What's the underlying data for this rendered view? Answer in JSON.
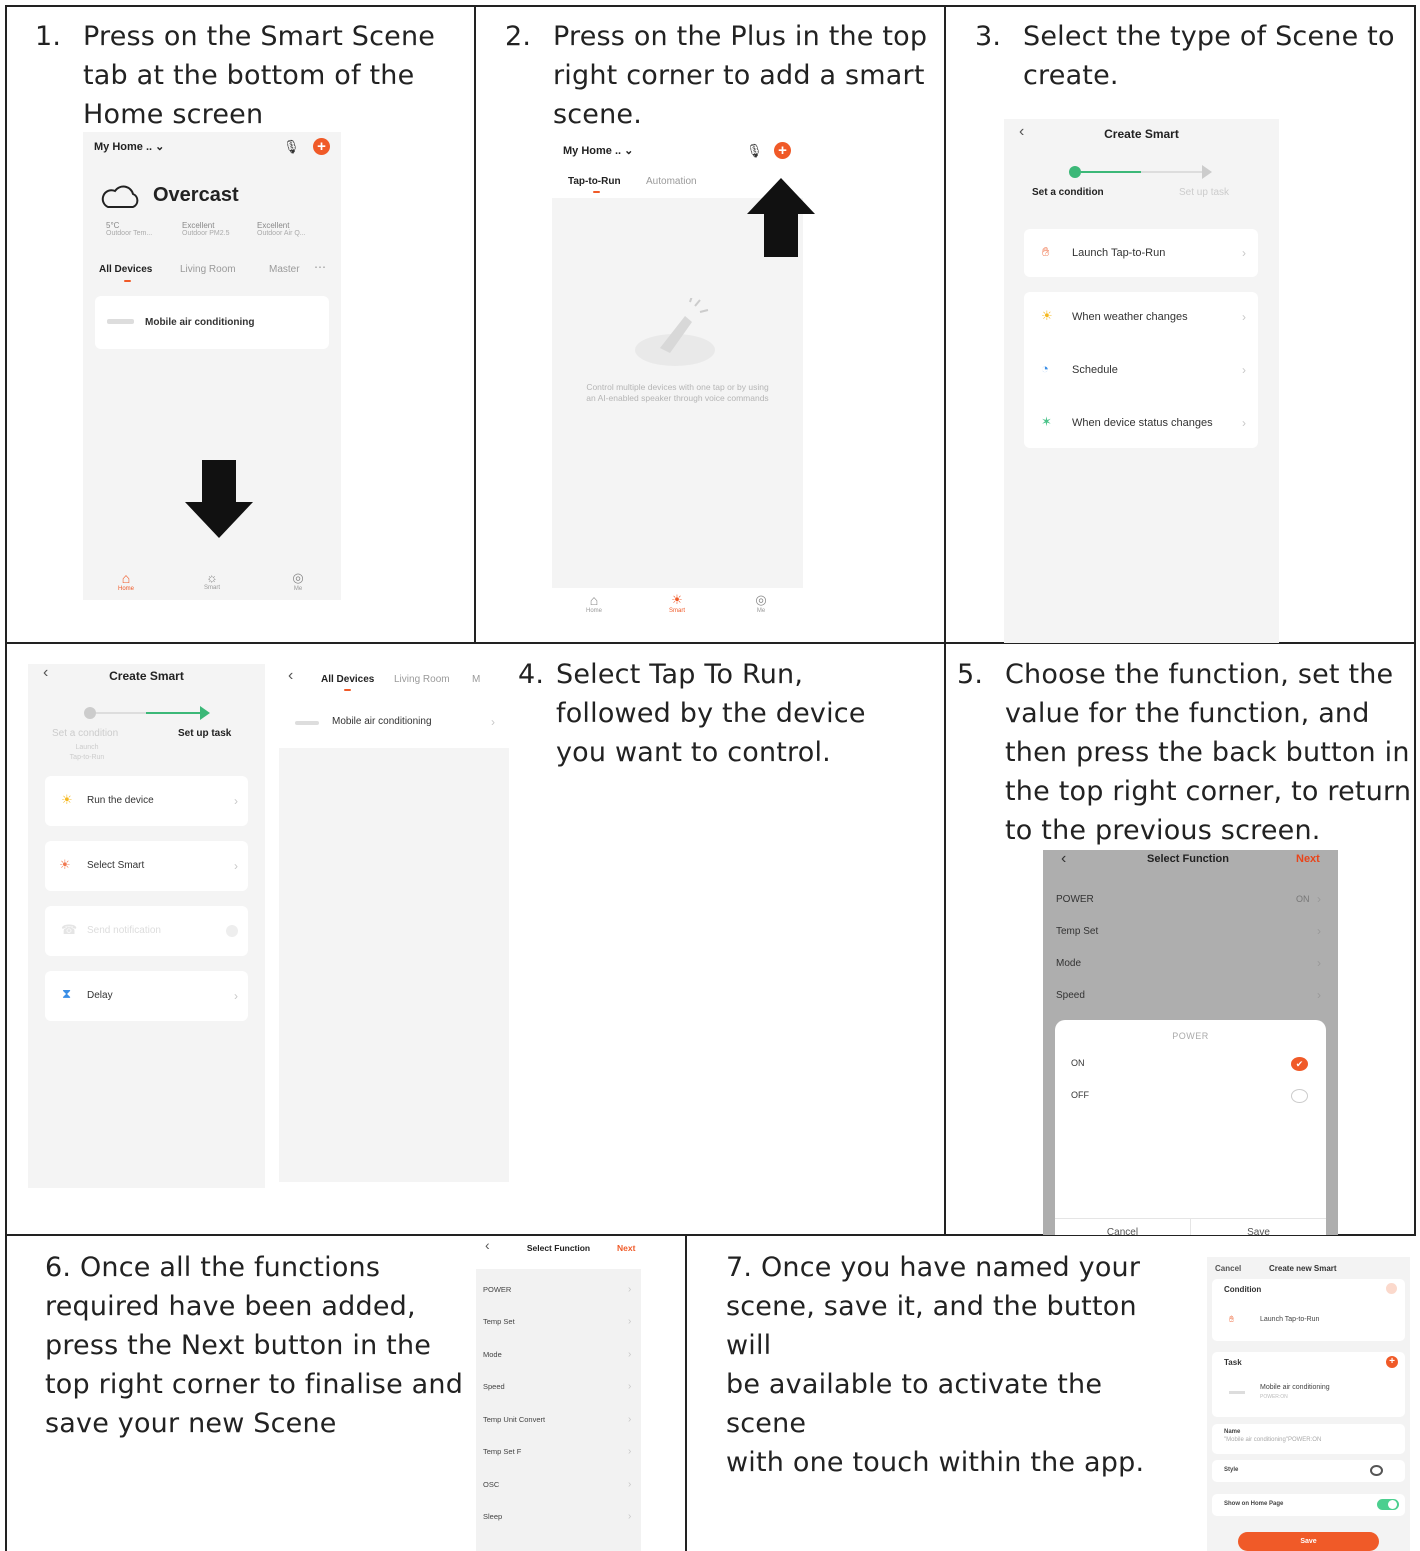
{
  "steps": {
    "s1": {
      "num": "1.",
      "lines": [
        "Press on the Smart Scene",
        "tab at the bottom of the",
        "Home screen"
      ]
    },
    "s2": {
      "num": "2.",
      "lines": [
        "Press on the Plus in the top",
        "right corner to add a smart",
        "scene."
      ]
    },
    "s3": {
      "num": "3.",
      "lines": [
        "Select the type of Scene to",
        "create."
      ]
    },
    "s4": {
      "num": "4.",
      "lines": [
        "Select Tap To Run,",
        "followed by the device",
        "you want to control."
      ]
    },
    "s5": {
      "num": "5.",
      "lines": [
        "Choose the function, set the",
        "value for the function, and",
        "then press the back button in",
        "the top right corner, to return",
        "to the previous screen."
      ]
    },
    "s6": {
      "lines": [
        "6.  Once all the functions",
        "required have been added,",
        "press the Next button in the",
        "top right corner to finalise and",
        "save your new Scene"
      ]
    },
    "s7": {
      "lines": [
        "7.  Once you have named your",
        "scene, save it, and the button will",
        "be available to activate the scene",
        "with one touch within the app."
      ]
    }
  },
  "p1": {
    "home_title": "My Home .. ⌄",
    "weather": "Overcast",
    "stats": [
      {
        "v": "5°C",
        "l": "Outdoor Tem..."
      },
      {
        "v": "Excellent",
        "l": "Outdoor PM2.5"
      },
      {
        "v": "Excellent",
        "l": "Outdoor Air Q..."
      }
    ],
    "tabs": [
      "All Devices",
      "Living Room",
      "Master",
      "⋯"
    ],
    "device": "Mobile air conditioning",
    "nav": [
      "Home",
      "Smart",
      "Me"
    ]
  },
  "p2": {
    "home_title": "My Home .. ⌄",
    "tabs": [
      "Tap-to-Run",
      "Automation"
    ],
    "empty": [
      "Control multiple devices with one tap or by using",
      "an AI-enabled speaker through voice commands"
    ],
    "nav": [
      "Home",
      "Smart",
      "Me"
    ]
  },
  "p3": {
    "title": "Create Smart",
    "progress": [
      "Set a condition",
      "Set up task"
    ],
    "items": [
      "Launch Tap-to-Run",
      "When weather changes",
      "Schedule",
      "When device status changes"
    ]
  },
  "p4a": {
    "title": "Create Smart",
    "progress": [
      "Set a condition",
      "Set up task"
    ],
    "progress_sub": "Launch\nTap-to-Run",
    "items": [
      "Run the device",
      "Select Smart",
      "Send notification",
      "Delay"
    ]
  },
  "p4b": {
    "tabs": [
      "All Devices",
      "Living Room",
      "M"
    ],
    "device": "Mobile air conditioning"
  },
  "p5": {
    "title": "Select Function",
    "next": "Next",
    "rows": [
      {
        "l": "POWER",
        "v": "ON"
      },
      {
        "l": "Temp Set",
        "v": ""
      },
      {
        "l": "Mode",
        "v": ""
      },
      {
        "l": "Speed",
        "v": ""
      }
    ],
    "sheet_title": "POWER",
    "options": [
      "ON",
      "OFF"
    ],
    "buttons": [
      "Cancel",
      "Save"
    ]
  },
  "p6": {
    "title": "Select Function",
    "next": "Next",
    "rows": [
      "POWER",
      "Temp Set",
      "Mode",
      "Speed",
      "Temp Unit Convert",
      "Temp Set F",
      "OSC",
      "Sleep"
    ]
  },
  "p7": {
    "cancel": "Cancel",
    "title": "Create new Smart",
    "condition": "Condition",
    "cond_item": "Launch Tap-to-Run",
    "task": "Task",
    "task_item": "Mobile air conditioning",
    "task_sub": "POWER:ON",
    "name_label": "Name",
    "name_value": "\"Mobile air conditioning\"POWER:ON",
    "style": "Style",
    "show": "Show on Home Page",
    "save": "Save"
  },
  "colors": {
    "accent": "#f05a28",
    "green": "#3cb878",
    "toggle": "#4ccf8f"
  }
}
